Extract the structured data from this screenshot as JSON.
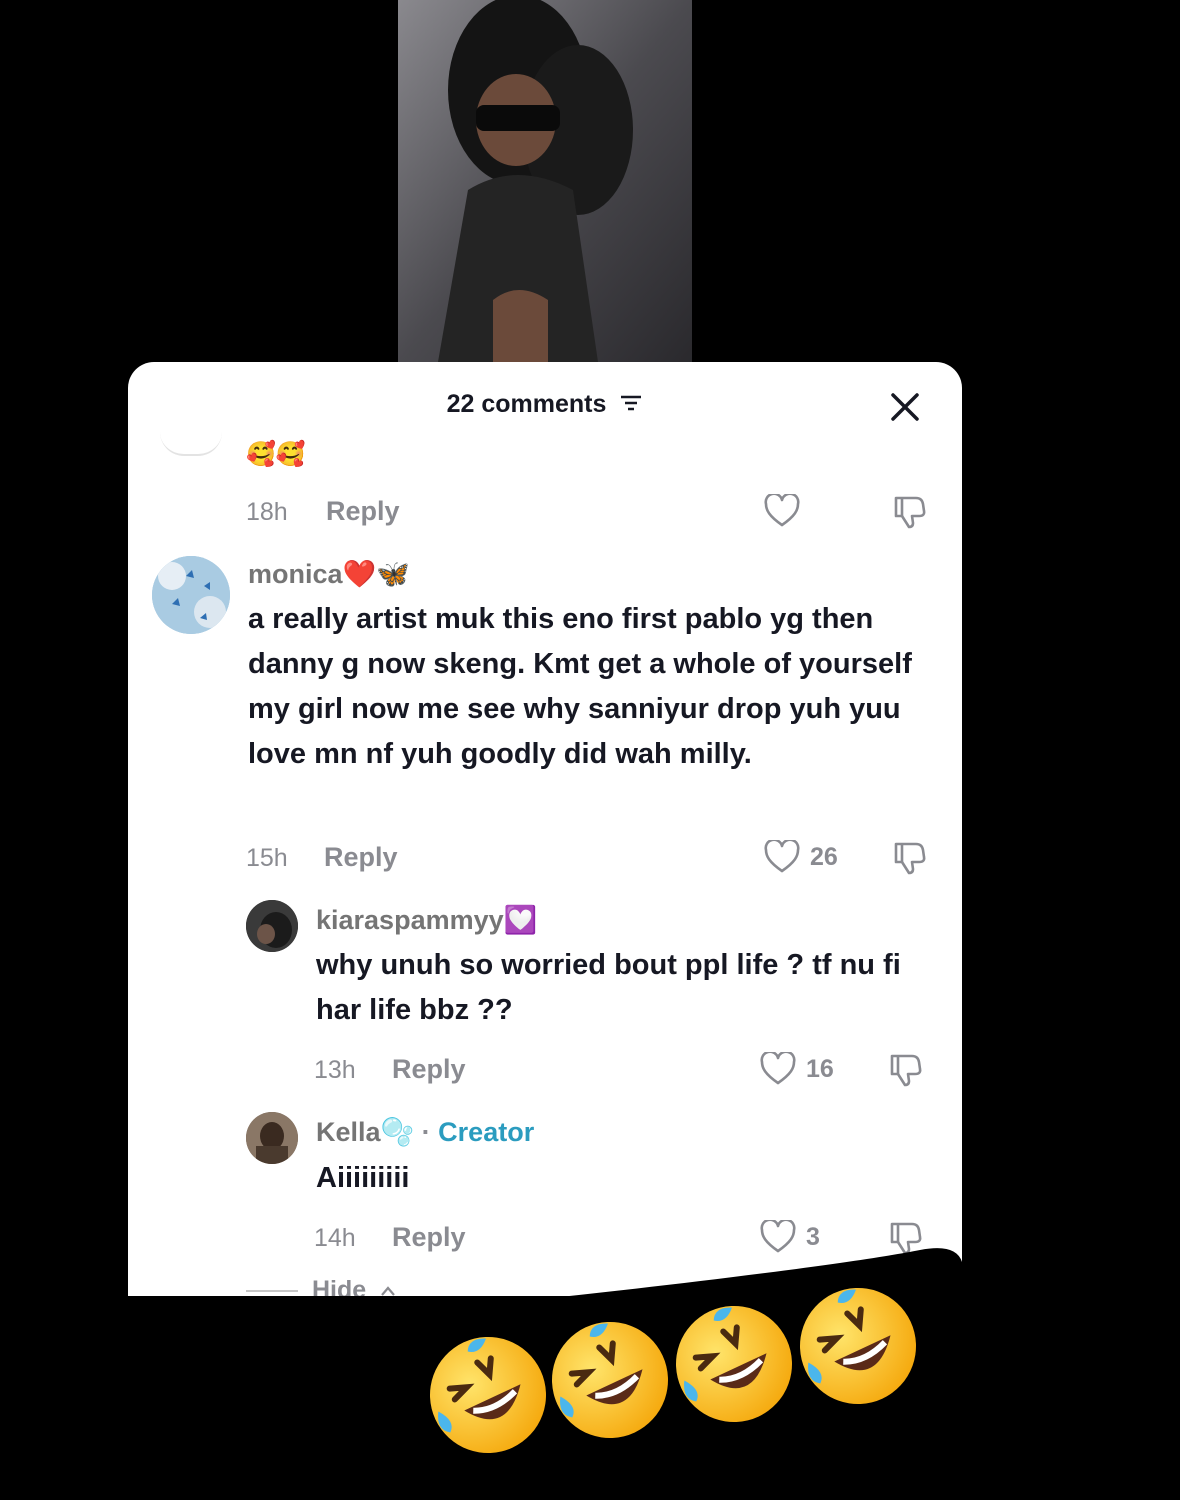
{
  "video": {},
  "sheet": {
    "header": {
      "comments_count_label": "22 comments"
    },
    "partial_top": {
      "emoji": "🥰🥰",
      "time": "18h",
      "reply_label": "Reply"
    },
    "comments": [
      {
        "username": "monica❤️🦋",
        "text": "a really artist muk this eno first pablo yg then danny g now skeng. Kmt get a whole of yourself my girl now me see why sanniyur drop yuh yuu love mn nf yuh goodly did wah milly.",
        "time": "15h",
        "reply_label": "Reply",
        "likes": "26"
      },
      {
        "username": "kiaraspammyy💟",
        "text": "why unuh so worried bout ppl life ? tf nu fi har life bbz ??",
        "time": "13h",
        "reply_label": "Reply",
        "likes": "16"
      },
      {
        "username": "Kella🫧",
        "creator_label": "Creator",
        "text": "Aiiiiiiiii",
        "time": "14h",
        "reply_label": "Reply",
        "likes": "3"
      }
    ],
    "hide_label": "Hide"
  },
  "overlay": {
    "emojis": [
      "🤣",
      "🤣",
      "🤣",
      "🤣"
    ]
  },
  "colors": {
    "background": "#000000",
    "sheet": "#ffffff",
    "creator": "#2b9cbf",
    "muted": "#8a8b91",
    "text": "#161823"
  }
}
